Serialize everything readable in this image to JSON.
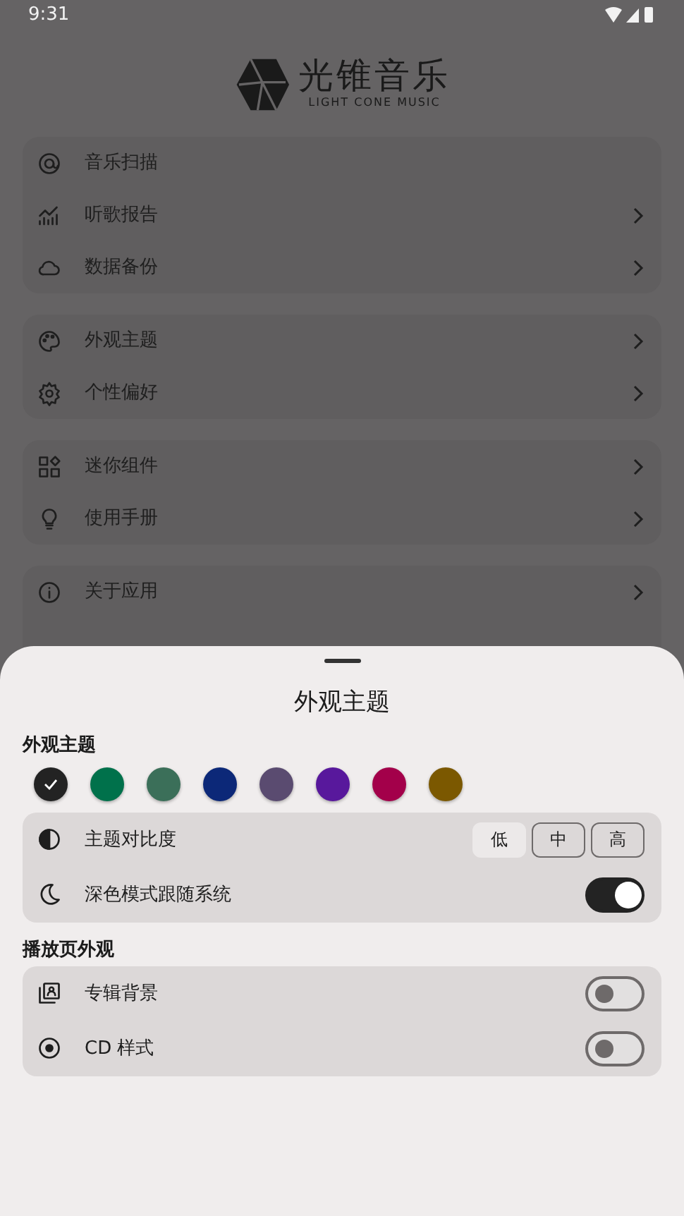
{
  "status_bar": {
    "time": "9:31"
  },
  "logo": {
    "name": "光锥音乐",
    "subtitle": "LIGHT CONE MUSIC"
  },
  "menu_groups": [
    {
      "items": [
        {
          "label": "音乐扫描",
          "chevron": false
        },
        {
          "label": "听歌报告",
          "chevron": true
        },
        {
          "label": "数据备份",
          "chevron": true
        }
      ]
    },
    {
      "items": [
        {
          "label": "外观主题",
          "chevron": true
        },
        {
          "label": "个性偏好",
          "chevron": true
        }
      ]
    },
    {
      "items": [
        {
          "label": "迷你组件",
          "chevron": true
        },
        {
          "label": "使用手册",
          "chevron": true
        }
      ]
    },
    {
      "items": [
        {
          "label": "关于应用",
          "chevron": true
        }
      ]
    }
  ],
  "sheet": {
    "title": "外观主题",
    "sections": [
      {
        "title": "外观主题",
        "swatches": [
          {
            "color": "#232323",
            "selected": true
          },
          {
            "color": "#00714b",
            "selected": false
          },
          {
            "color": "#3b6f59",
            "selected": false
          },
          {
            "color": "#0c2878",
            "selected": false
          },
          {
            "color": "#5a4b70",
            "selected": false
          },
          {
            "color": "#58189c",
            "selected": false
          },
          {
            "color": "#a3004a",
            "selected": false
          },
          {
            "color": "#7b5800",
            "selected": false
          }
        ],
        "rows": [
          {
            "kind": "segmented",
            "label": "主题对比度",
            "options": [
              {
                "label": "低",
                "selected": true
              },
              {
                "label": "中",
                "selected": false
              },
              {
                "label": "高",
                "selected": false
              }
            ]
          },
          {
            "kind": "switch",
            "label": "深色模式跟随系统",
            "on": true
          }
        ]
      },
      {
        "title": "播放页外观",
        "rows": [
          {
            "kind": "switch",
            "label": "专辑背景",
            "on": false
          },
          {
            "kind": "switch",
            "label": "CD 样式",
            "on": false
          }
        ]
      }
    ]
  }
}
